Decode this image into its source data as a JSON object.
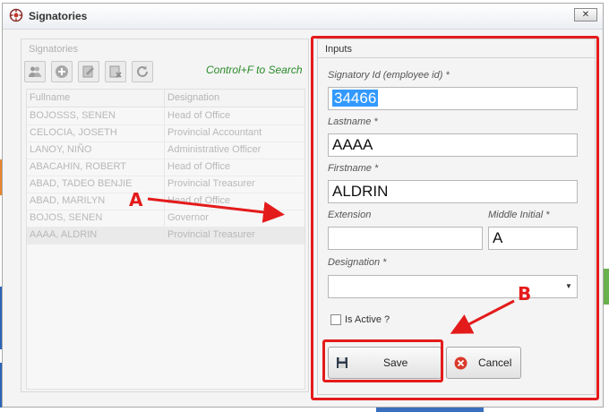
{
  "window": {
    "title": "Signatories",
    "close_label": "✕",
    "app_icon": "settings-gear-icon"
  },
  "left_panel": {
    "group_label": "Signatories",
    "toolbar": [
      {
        "name": "users-icon",
        "label": "users"
      },
      {
        "name": "add-icon",
        "label": "add"
      },
      {
        "name": "edit-icon",
        "label": "edit"
      },
      {
        "name": "delete-icon",
        "label": "delete"
      },
      {
        "name": "refresh-icon",
        "label": "refresh"
      }
    ],
    "search_hint": "Control+F to Search",
    "grid": {
      "columns": [
        "Fullname",
        "Designation"
      ],
      "rows": [
        [
          "BOJOSSS, SENEN",
          "Head of Office"
        ],
        [
          "CELOCIA, JOSETH",
          "Provincial Accountant"
        ],
        [
          "LANOY, NIÑO",
          "Administrative Officer"
        ],
        [
          "ABACAHIN, ROBERT",
          "Head of Office"
        ],
        [
          "ABAD, TADEO BENJIE",
          "Provincial Treasurer"
        ],
        [
          "ABAD, MARILYN",
          "Head of Office"
        ],
        [
          "BOJOS, SENEN",
          "Governor"
        ],
        [
          "AAAA, ALDRIN",
          "Provincial Treasurer"
        ]
      ],
      "selected_row_index": 7
    }
  },
  "inputs_panel": {
    "header": "Inputs",
    "signatory_id_label": "Signatory Id (employee id) *",
    "signatory_id_value": "34466",
    "lastname_label": "Lastname *",
    "lastname_value": "AAAA",
    "firstname_label": "Firstname *",
    "firstname_value": "ALDRIN",
    "extension_label": "Extension",
    "extension_value": "",
    "middle_initial_label": "Middle Initial *",
    "middle_initial_value": "A",
    "designation_label": "Designation *",
    "designation_value": "",
    "is_active_label": "Is Active ?",
    "is_active_checked": false,
    "save_label": "Save",
    "cancel_label": "Cancel"
  },
  "annotations": {
    "label_a": "A",
    "label_b": "B",
    "color": "#e41b1b"
  }
}
